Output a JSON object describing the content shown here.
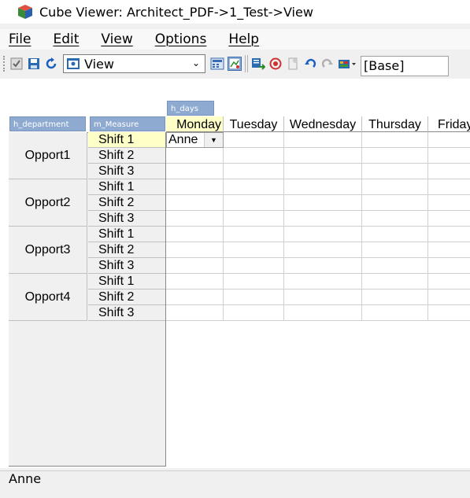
{
  "window": {
    "title": "Cube Viewer: Architect_PDF->1_Test->View"
  },
  "menu": [
    {
      "label": "File"
    },
    {
      "label": "Edit"
    },
    {
      "label": "View"
    },
    {
      "label": "Options"
    },
    {
      "label": "Help"
    }
  ],
  "toolbar": {
    "view_name": "View",
    "base_label": "[Base]"
  },
  "dims": {
    "column_dim": "h_days",
    "row_dim_1": "h_department",
    "row_dim_2": "m_Measure"
  },
  "columns": [
    "Monday",
    "Tuesday",
    "Wednesday",
    "Thursday",
    "Friday"
  ],
  "rows": [
    {
      "dept": "Opport1",
      "shifts": [
        "Shift 1",
        "Shift 2",
        "Shift 3"
      ]
    },
    {
      "dept": "Opport2",
      "shifts": [
        "Shift 1",
        "Shift 2",
        "Shift 3"
      ]
    },
    {
      "dept": "Opport3",
      "shifts": [
        "Shift 1",
        "Shift 2",
        "Shift 3"
      ]
    },
    {
      "dept": "Opport4",
      "shifts": [
        "Shift 1",
        "Shift 2",
        "Shift 3"
      ]
    }
  ],
  "active_cell": {
    "value": "Anne"
  },
  "status": {
    "text": "Anne"
  },
  "colors": {
    "dim_button": "#8eaad0",
    "highlight": "#ffffc8"
  }
}
